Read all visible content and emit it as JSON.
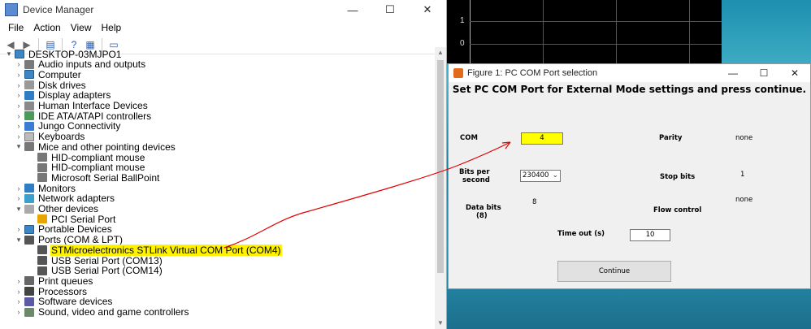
{
  "device_manager": {
    "title": "Device Manager",
    "menu": [
      "File",
      "Action",
      "View",
      "Help"
    ],
    "window_controls": {
      "minimize": "—",
      "maximize": "☐",
      "close": "✕"
    },
    "toolbar_icons": [
      "back-icon",
      "forward-icon",
      "properties-icon",
      "help-icon",
      "view-icon",
      "monitor-icon"
    ],
    "root": "DESKTOP-03MJPO1",
    "tree": [
      {
        "label": "Audio inputs and outputs",
        "level": 1,
        "expanded": false,
        "icon": "audio"
      },
      {
        "label": "Computer",
        "level": 1,
        "expanded": false,
        "icon": "computer"
      },
      {
        "label": "Disk drives",
        "level": 1,
        "expanded": false,
        "icon": "disk"
      },
      {
        "label": "Display adapters",
        "level": 1,
        "expanded": false,
        "icon": "display"
      },
      {
        "label": "Human Interface Devices",
        "level": 1,
        "expanded": false,
        "icon": "hid"
      },
      {
        "label": "IDE ATA/ATAPI controllers",
        "level": 1,
        "expanded": false,
        "icon": "ide"
      },
      {
        "label": "Jungo Connectivity",
        "level": 1,
        "expanded": false,
        "icon": "jungo"
      },
      {
        "label": "Keyboards",
        "level": 1,
        "expanded": false,
        "icon": "keyboard"
      },
      {
        "label": "Mice and other pointing devices",
        "level": 1,
        "expanded": true,
        "icon": "mouse"
      },
      {
        "label": "HID-compliant mouse",
        "level": 2,
        "icon": "mouse"
      },
      {
        "label": "HID-compliant mouse",
        "level": 2,
        "icon": "mouse"
      },
      {
        "label": "Microsoft Serial BallPoint",
        "level": 2,
        "icon": "mouse-warning"
      },
      {
        "label": "Monitors",
        "level": 1,
        "expanded": false,
        "icon": "monitor"
      },
      {
        "label": "Network adapters",
        "level": 1,
        "expanded": false,
        "icon": "network"
      },
      {
        "label": "Other devices",
        "level": 1,
        "expanded": true,
        "icon": "other"
      },
      {
        "label": "PCI Serial Port",
        "level": 2,
        "icon": "warning"
      },
      {
        "label": "Portable Devices",
        "level": 1,
        "expanded": false,
        "icon": "portable"
      },
      {
        "label": "Ports (COM & LPT)",
        "level": 1,
        "expanded": true,
        "icon": "port"
      },
      {
        "label": "STMicroelectronics STLink Virtual COM Port (COM4)",
        "level": 2,
        "icon": "port",
        "highlighted": true
      },
      {
        "label": "USB Serial Port (COM13)",
        "level": 2,
        "icon": "port"
      },
      {
        "label": "USB Serial Port (COM14)",
        "level": 2,
        "icon": "port"
      },
      {
        "label": "Print queues",
        "level": 1,
        "expanded": false,
        "icon": "print"
      },
      {
        "label": "Processors",
        "level": 1,
        "expanded": false,
        "icon": "cpu"
      },
      {
        "label": "Software devices",
        "level": 1,
        "expanded": false,
        "icon": "software"
      },
      {
        "label": "Sound, video and game controllers",
        "level": 1,
        "expanded": false,
        "icon": "sound"
      }
    ]
  },
  "scope": {
    "ticks": [
      "1",
      "0"
    ]
  },
  "figure": {
    "title": "Figure 1: PC COM Port selection",
    "window_controls": {
      "minimize": "—",
      "maximize": "☐",
      "close": "✕"
    },
    "heading": "Set PC COM Port for External Mode settings and press continue.",
    "com_label": "COM",
    "com_value": "4",
    "parity_label": "Parity",
    "parity_value": "none",
    "bits_per_second_label_1": "Bits per",
    "bits_per_second_label_2": "second",
    "bits_per_second_value": "230400",
    "stop_bits_label": "Stop bits",
    "stop_bits_value": "1",
    "data_bits_label_1": "Data bits",
    "data_bits_label_2": "(8)",
    "data_bits_value": "8",
    "flow_control_label": "Flow control",
    "flow_control_value": "none",
    "timeout_label": "Time out (s)",
    "timeout_value": "10",
    "continue_label": "Continue"
  },
  "colors": {
    "highlight": "#fff200",
    "annotation_arrow": "#e00000"
  }
}
